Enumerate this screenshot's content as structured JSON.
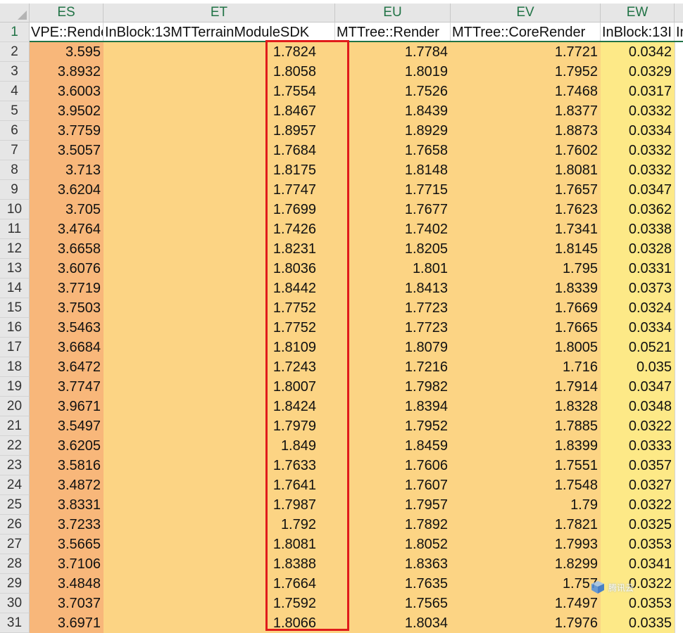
{
  "columns": [
    {
      "letter": "ES",
      "header": "VPE::Render"
    },
    {
      "letter": "ET",
      "header": "InBlock:13MTTerrainModuleSDK"
    },
    {
      "letter": "EU",
      "header": "MTTree::Render"
    },
    {
      "letter": "EV",
      "header": "MTTree::CoreRender"
    },
    {
      "letter": "EW",
      "header": "InBlock:13I"
    },
    {
      "letter": "",
      "header": "In"
    }
  ],
  "header_row_number": "1",
  "rows": [
    {
      "n": "2",
      "es": "3.595",
      "et": "1.7824",
      "eu": "1.7784",
      "ev": "1.7721",
      "ew": "0.0342"
    },
    {
      "n": "3",
      "es": "3.8932",
      "et": "1.8058",
      "eu": "1.8019",
      "ev": "1.7952",
      "ew": "0.0329"
    },
    {
      "n": "4",
      "es": "3.6003",
      "et": "1.7554",
      "eu": "1.7526",
      "ev": "1.7468",
      "ew": "0.0317"
    },
    {
      "n": "5",
      "es": "3.9502",
      "et": "1.8467",
      "eu": "1.8439",
      "ev": "1.8377",
      "ew": "0.0332"
    },
    {
      "n": "6",
      "es": "3.7759",
      "et": "1.8957",
      "eu": "1.8929",
      "ev": "1.8873",
      "ew": "0.0334"
    },
    {
      "n": "7",
      "es": "3.5057",
      "et": "1.7684",
      "eu": "1.7658",
      "ev": "1.7602",
      "ew": "0.0332"
    },
    {
      "n": "8",
      "es": "3.713",
      "et": "1.8175",
      "eu": "1.8148",
      "ev": "1.8081",
      "ew": "0.0332"
    },
    {
      "n": "9",
      "es": "3.6204",
      "et": "1.7747",
      "eu": "1.7715",
      "ev": "1.7657",
      "ew": "0.0347"
    },
    {
      "n": "10",
      "es": "3.705",
      "et": "1.7699",
      "eu": "1.7677",
      "ev": "1.7623",
      "ew": "0.0362"
    },
    {
      "n": "11",
      "es": "3.4764",
      "et": "1.7426",
      "eu": "1.7402",
      "ev": "1.7341",
      "ew": "0.0338"
    },
    {
      "n": "12",
      "es": "3.6658",
      "et": "1.8231",
      "eu": "1.8205",
      "ev": "1.8145",
      "ew": "0.0328"
    },
    {
      "n": "13",
      "es": "3.6076",
      "et": "1.8036",
      "eu": "1.801",
      "ev": "1.795",
      "ew": "0.0331"
    },
    {
      "n": "14",
      "es": "3.7719",
      "et": "1.8442",
      "eu": "1.8413",
      "ev": "1.8339",
      "ew": "0.0373"
    },
    {
      "n": "15",
      "es": "3.7503",
      "et": "1.7752",
      "eu": "1.7723",
      "ev": "1.7669",
      "ew": "0.0324"
    },
    {
      "n": "16",
      "es": "3.5463",
      "et": "1.7752",
      "eu": "1.7723",
      "ev": "1.7665",
      "ew": "0.0334"
    },
    {
      "n": "17",
      "es": "3.6684",
      "et": "1.8109",
      "eu": "1.8079",
      "ev": "1.8005",
      "ew": "0.0521"
    },
    {
      "n": "18",
      "es": "3.6472",
      "et": "1.7243",
      "eu": "1.7216",
      "ev": "1.716",
      "ew": "0.035"
    },
    {
      "n": "19",
      "es": "3.7747",
      "et": "1.8007",
      "eu": "1.7982",
      "ev": "1.7914",
      "ew": "0.0347"
    },
    {
      "n": "20",
      "es": "3.9671",
      "et": "1.8424",
      "eu": "1.8394",
      "ev": "1.8328",
      "ew": "0.0348"
    },
    {
      "n": "21",
      "es": "3.5497",
      "et": "1.7979",
      "eu": "1.7952",
      "ev": "1.7885",
      "ew": "0.0322"
    },
    {
      "n": "22",
      "es": "3.6205",
      "et": "1.849",
      "eu": "1.8459",
      "ev": "1.8399",
      "ew": "0.0333"
    },
    {
      "n": "23",
      "es": "3.5816",
      "et": "1.7633",
      "eu": "1.7606",
      "ev": "1.7551",
      "ew": "0.0357"
    },
    {
      "n": "24",
      "es": "3.4872",
      "et": "1.7641",
      "eu": "1.7607",
      "ev": "1.7548",
      "ew": "0.0327"
    },
    {
      "n": "25",
      "es": "3.8331",
      "et": "1.7987",
      "eu": "1.7957",
      "ev": "1.79",
      "ew": "0.0322"
    },
    {
      "n": "26",
      "es": "3.7233",
      "et": "1.792",
      "eu": "1.7892",
      "ev": "1.7821",
      "ew": "0.0325"
    },
    {
      "n": "27",
      "es": "3.5665",
      "et": "1.8081",
      "eu": "1.8052",
      "ev": "1.7993",
      "ew": "0.0353"
    },
    {
      "n": "28",
      "es": "3.7106",
      "et": "1.8388",
      "eu": "1.8363",
      "ev": "1.8299",
      "ew": "0.0341"
    },
    {
      "n": "29",
      "es": "3.4848",
      "et": "1.7664",
      "eu": "1.7635",
      "ev": "1.757",
      "ew": "0.0322"
    },
    {
      "n": "30",
      "es": "3.7037",
      "et": "1.7592",
      "eu": "1.7565",
      "ev": "1.7497",
      "ew": "0.0353"
    },
    {
      "n": "31",
      "es": "3.6971",
      "et": "1.8066",
      "eu": "1.8034",
      "ev": "1.7976",
      "ew": "0.0335"
    }
  ],
  "colors": {
    "es_fill": "#f8b77a",
    "et_fill": "#fcd484",
    "eu_fill": "#fcd484",
    "ev_fill": "#fcd484",
    "ew_fill": "#fde987",
    "highlight_box": "#e01b1b",
    "header_text": "#217346"
  },
  "watermark": {
    "icon": "cube-logo-icon",
    "text": "腾讯云"
  }
}
